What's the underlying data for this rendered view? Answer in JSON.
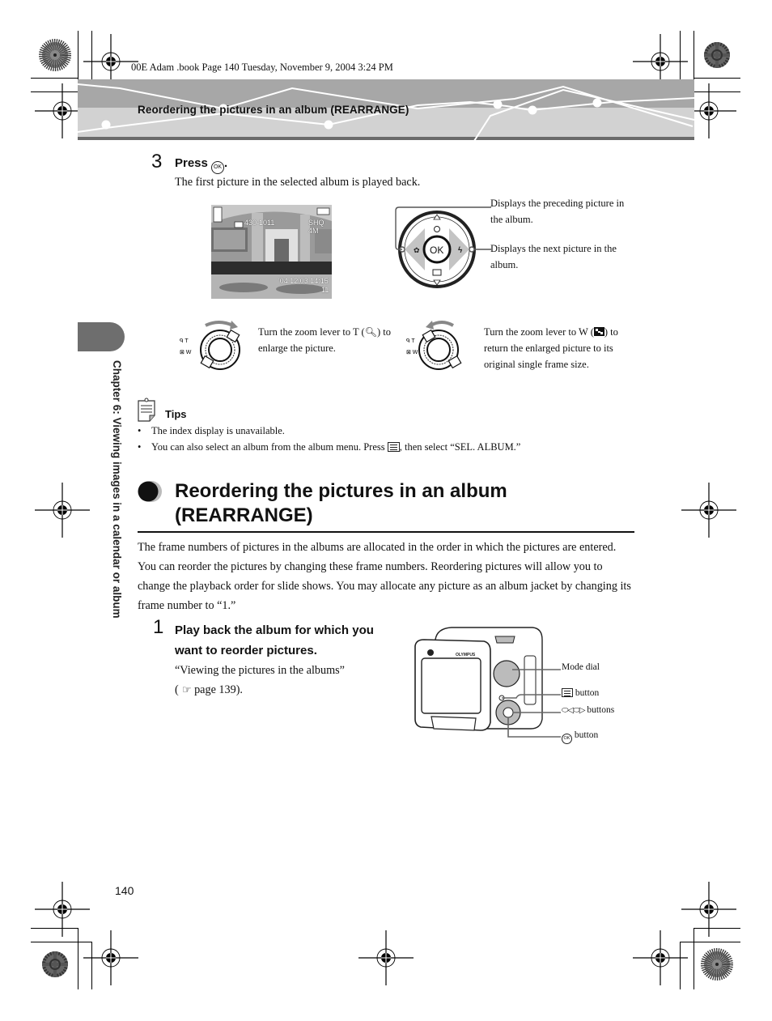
{
  "print_slug": "00E Adam .book  Page 140  Tuesday, November 9, 2004  3:24 PM",
  "header": {
    "title": "Reordering the pictures in an album (REARRANGE)"
  },
  "chapter_tab": {
    "label": "Chapter 6: Viewing images in a calendar or album"
  },
  "step3": {
    "number": "3",
    "heading_prefix": "Press",
    "heading_button_glyph": "OK",
    "heading_suffix": ".",
    "description": "The first picture in the selected album is played back."
  },
  "lcd_preview": {
    "top_left_icon": "album-icon",
    "album_counter": "430-1011",
    "quality": "SHQ",
    "resolution": "4M",
    "timestamp": "'04.12.03 14:15",
    "frame": "11",
    "protect_icon": "key-icon"
  },
  "dpad": {
    "center_label": "OK",
    "up_icon": "self-timer-icon",
    "down_icon": "print-icon",
    "left_icon": "macro-icon",
    "right_icon": "flash-icon",
    "callout_left": "Displays the preceding picture in the album.",
    "callout_right": "Displays the next picture in the album."
  },
  "zoom_t": {
    "lever_labels": [
      "T",
      "W"
    ],
    "text_prefix": "Turn the zoom lever to T (",
    "text_suffix": ") to enlarge the picture.",
    "icon": "magnify-icon"
  },
  "zoom_w": {
    "lever_labels": [
      "T",
      "W"
    ],
    "text_prefix": "Turn the zoom lever to W (",
    "text_suffix": ") to return the enlarged picture to its original single frame size.",
    "icon": "index-icon"
  },
  "tips": {
    "label": "Tips",
    "items": [
      {
        "text": "The index display is unavailable."
      },
      {
        "text_before": "You can also select an album from the album menu. Press ",
        "text_after": ", then select “SEL. ALBUM.”"
      }
    ]
  },
  "section": {
    "title_line1": "Reordering the pictures in an album",
    "title_line2": "(REARRANGE)",
    "intro": "The frame numbers of pictures in the albums are allocated in the order in which the pictures are entered. You can reorder the pictures by changing these frame numbers. Reordering pictures will allow you to change the playback order for slide shows. You may allocate any picture as an album jacket by changing its frame number to “1.”"
  },
  "step1": {
    "number": "1",
    "heading_line1": "Play back the album for which you",
    "heading_line2": "want to reorder pictures.",
    "ref_line1": "“Viewing the pictures in the albums”",
    "ref_open": "(",
    "ref_page": " page 139)."
  },
  "camera_callouts": {
    "mode_dial": "Mode dial",
    "menu_button": "button",
    "arrow_buttons": "buttons",
    "ok_button": "button",
    "brand": "OLYMPUS"
  },
  "page_number": "140"
}
